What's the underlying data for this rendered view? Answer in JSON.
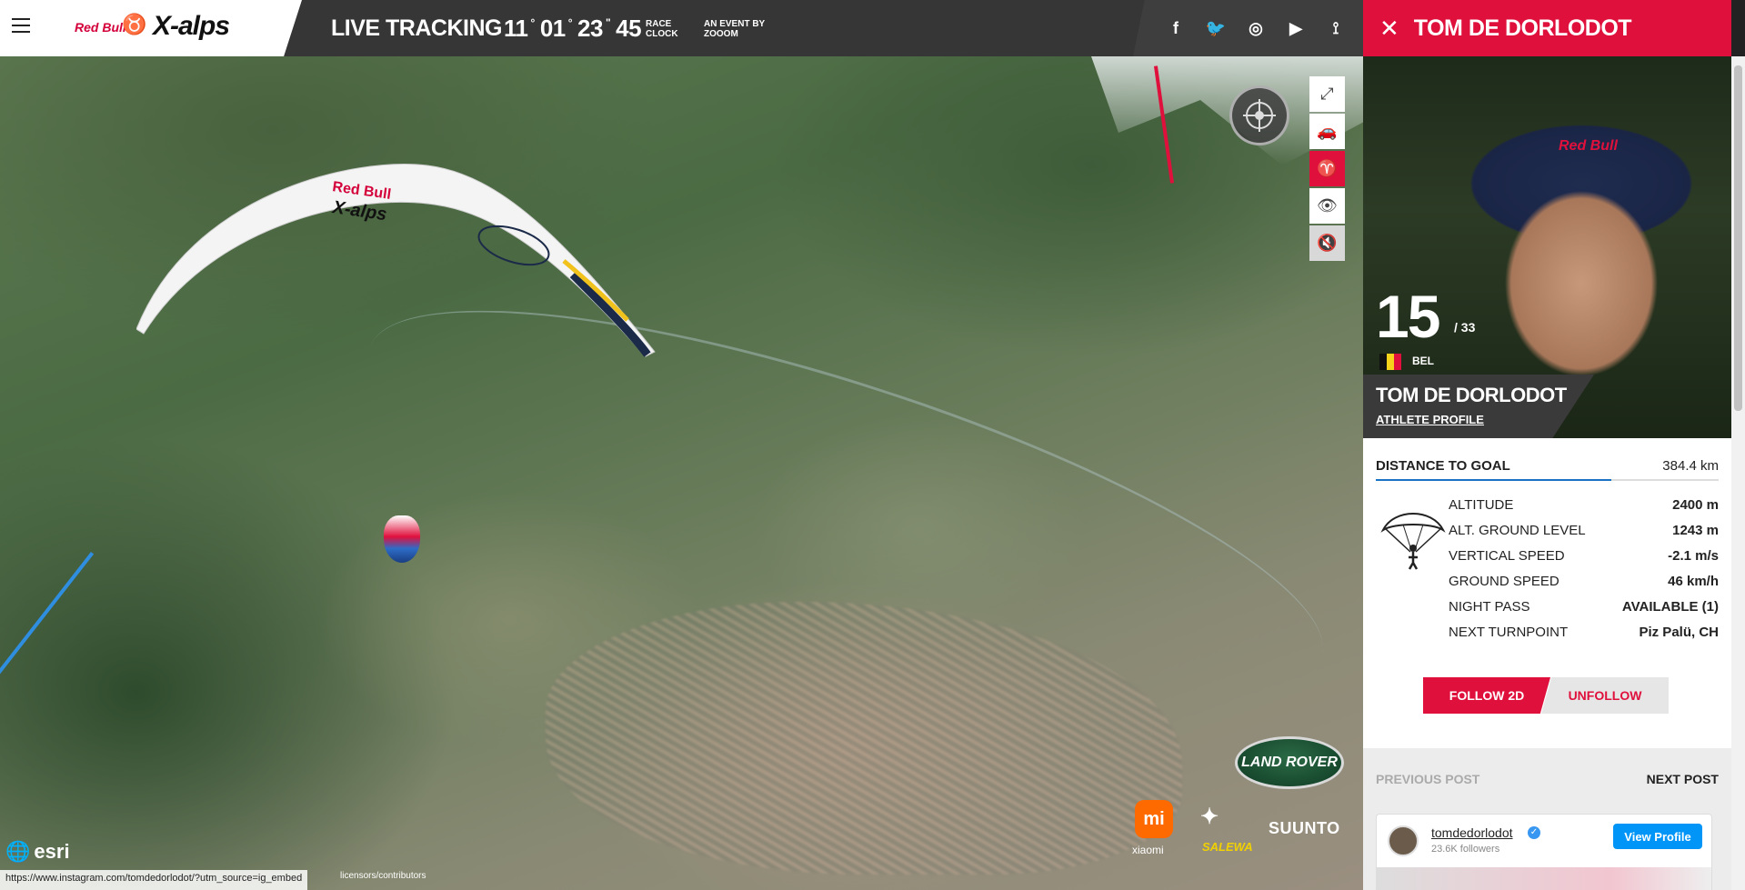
{
  "header": {
    "logo_brand": "Red Bull",
    "logo_event": "X-alps",
    "title": "LIVE TRACKING",
    "clock": {
      "days": "11",
      "hours": "01",
      "minutes": "23",
      "seconds": "45"
    },
    "clock_label_1": "RACE",
    "clock_label_2": "CLOCK",
    "event_by_1": "AN EVENT BY",
    "event_by_2": "ZOOOM",
    "social": [
      {
        "icon": "facebook-icon",
        "glyph": "f"
      },
      {
        "icon": "twitter-icon",
        "glyph": "🐦"
      },
      {
        "icon": "instagram-icon",
        "glyph": "◎"
      },
      {
        "icon": "youtube-icon",
        "glyph": "▶"
      },
      {
        "icon": "rss-icon",
        "glyph": "⟟"
      }
    ]
  },
  "map": {
    "sponsors": {
      "land_rover": "LAND ROVER",
      "mi_label": "xiaomi",
      "salewa": "SALEWA",
      "suunto": "SUUNTO"
    },
    "esri": "esri",
    "status_url": "https://www.instagram.com/tomdedorlodot/?utm_source=ig_embed",
    "attribution": "licensors/contributors"
  },
  "panel": {
    "title": "TOM DE DORLODOT",
    "rank": "15",
    "rank_total": "/ 33",
    "nation": "BEL",
    "athlete_name": "TOM DE DORLODOT",
    "athlete_profile": "ATHLETE PROFILE",
    "distance_label": "DISTANCE TO GOAL",
    "distance_value": "384.4 km",
    "stats": [
      {
        "label": "ALTITUDE",
        "value": "2400 m"
      },
      {
        "label": "ALT. GROUND LEVEL",
        "value": "1243 m"
      },
      {
        "label": "VERTICAL SPEED",
        "value": "-2.1 m/s"
      },
      {
        "label": "GROUND SPEED",
        "value": "46 km/h"
      },
      {
        "label": "NIGHT PASS",
        "value": "AVAILABLE (1)"
      },
      {
        "label": "NEXT TURNPOINT",
        "value": "Piz Palü, CH"
      }
    ],
    "follow_label": "FOLLOW 2D",
    "unfollow_label": "UNFOLLOW",
    "prev_post": "PREVIOUS POST",
    "next_post": "NEXT POST",
    "instagram": {
      "user": "tomdedorlodot",
      "followers": "23.6K followers",
      "view_profile": "View Profile"
    }
  },
  "colors": {
    "accent": "#e0103c",
    "header_bg": "#363636",
    "progress": "#1a72c4"
  }
}
